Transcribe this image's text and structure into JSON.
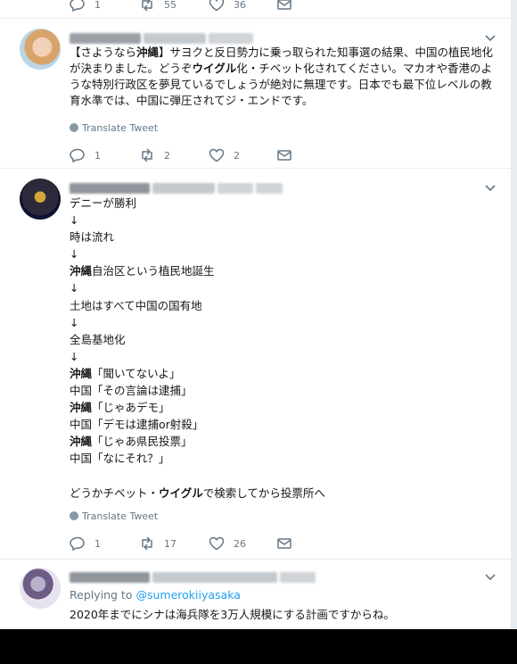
{
  "tweet0": {
    "actions": {
      "reply": "1",
      "retweet": "55",
      "like": "36"
    }
  },
  "tweet1": {
    "text_html": "【さようなら<b>沖縄</b>】サヨクと反日勢力に乗っ取られた知事選の結果、中国の植民地化が決まりました。どうぞ<b>ウイグル</b>化・チベット化されてください。マカオや香港のような特別行政区を夢見ているでしょうが絶対に無理です。日本でも最下位レベルの教育水準では、中国に弾圧されてジ・エンドです。",
    "translate": "Translate Tweet",
    "actions": {
      "reply": "1",
      "retweet": "2",
      "like": "2"
    }
  },
  "tweet2": {
    "lines_html": [
      "デニーが勝利",
      "↓",
      "時は流れ",
      "↓",
      "<b>沖縄</b>自治区という植民地誕生",
      "↓",
      "土地はすべて中国の国有地",
      "↓",
      "全島基地化",
      "↓",
      "<b>沖縄</b>「聞いてないよ」",
      "中国「その言論は逮捕」",
      "<b>沖縄</b>「じゃあデモ」",
      "中国「デモは逮捕or射殺」",
      "<b>沖縄</b>「じゃあ県民投票」",
      "中国「なにそれ？」",
      "",
      "どうかチベット・<b>ウイグル</b>で検索してから投票所へ"
    ],
    "translate": "Translate Tweet",
    "actions": {
      "reply": "1",
      "retweet": "17",
      "like": "26"
    }
  },
  "tweet3": {
    "replying_prefix": "Replying to",
    "replying_handle": "@sumerokiiyasaka",
    "text": "2020年までにシナは海兵隊を3万人規模にする計画ですからね。"
  },
  "colors": {
    "accent": "#1da1f2",
    "muted": "#657786",
    "text": "#14171a",
    "border": "#e6ecf0"
  },
  "icons": [
    "reply-icon",
    "retweet-icon",
    "like-icon",
    "message-icon",
    "chevron-down-icon",
    "globe-icon"
  ]
}
